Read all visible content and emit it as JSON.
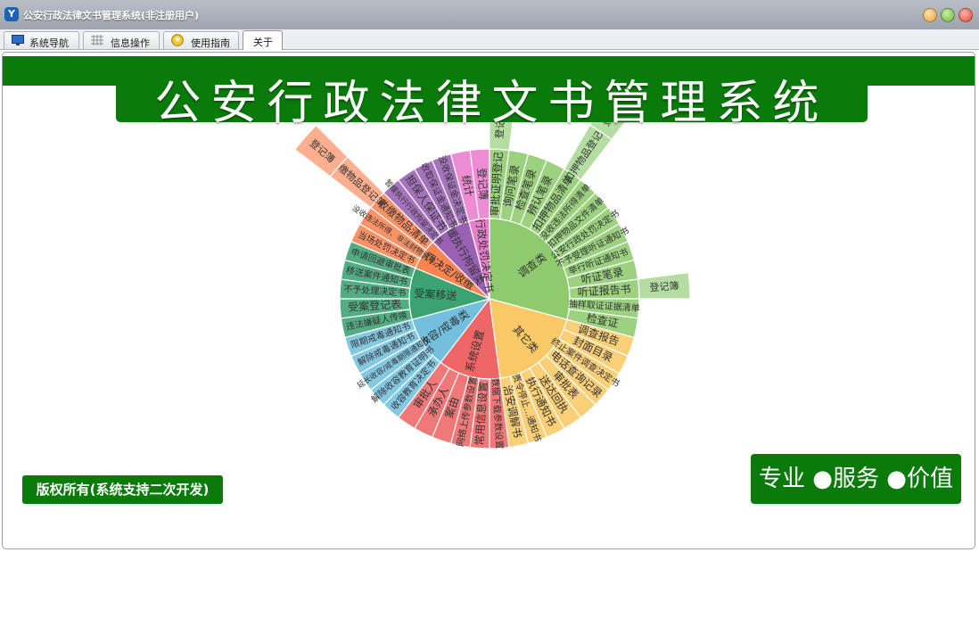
{
  "window": {
    "title": "公安行政法律文书管理系统(非注册用户)",
    "app_icon": "app-logo-icon",
    "controls": [
      {
        "name": "minimize-button",
        "color": "#e8a23c"
      },
      {
        "name": "maximize-button",
        "color": "#6ab33e"
      },
      {
        "name": "close-button",
        "color": "#e0463a"
      }
    ]
  },
  "tabs": [
    {
      "label": "系统导航",
      "icon": "monitor-icon",
      "active": false
    },
    {
      "label": "信息操作",
      "icon": "grid-icon",
      "active": false
    },
    {
      "label": "使用指南",
      "icon": "lightbulb-icon",
      "active": false
    },
    {
      "label": "关于",
      "icon": "",
      "active": true
    }
  ],
  "banner": {
    "title": "公安行政法律文书管理系统"
  },
  "footer": {
    "copyright": "版权所有(系统支持二次开发)",
    "slogan": "专业 ●服务 ●价值"
  },
  "colors": {
    "brand_green": "#0a7a0a"
  },
  "sunburst": {
    "categories": [
      {
        "name": "调查类",
        "color": "#8dcb6e",
        "items": [
          {
            "label": "审批证明登记",
            "outer": [
              "登记证"
            ]
          },
          {
            "label": "询问笔录",
            "outer": []
          },
          {
            "label": "检查笔录",
            "outer": []
          },
          {
            "label": "辨认笔录",
            "outer": []
          },
          {
            "label": "扣押物品清单",
            "outer": [
              "扣押物品登记簿",
              "登记簿"
            ]
          },
          {
            "label": "没收违法所得清单",
            "outer": []
          },
          {
            "label": "扣押物品文件清单",
            "outer": []
          },
          {
            "label": "公安行政处罚决定书",
            "outer": []
          },
          {
            "label": "不予受理听证通知书",
            "outer": []
          },
          {
            "label": "举行听证通知书",
            "outer": []
          },
          {
            "label": "听证笔录",
            "outer": []
          },
          {
            "label": "听证报告书",
            "outer": [
              "登记簿"
            ]
          },
          {
            "label": "抽样取证证据清单",
            "outer": []
          },
          {
            "label": "检查证",
            "outer": []
          }
        ]
      },
      {
        "name": "其它类",
        "color": "#f8c966",
        "items": [
          {
            "label": "调查报告",
            "outer": []
          },
          {
            "label": "封面目录",
            "outer": []
          },
          {
            "label": "终止案件调查决定书",
            "outer": []
          },
          {
            "label": "电话查询记录",
            "outer": []
          },
          {
            "label": "审批表",
            "outer": []
          },
          {
            "label": "送达回执",
            "outer": []
          },
          {
            "label": "执行通知书",
            "outer": []
          },
          {
            "label": "责令停止…通知书",
            "outer": []
          },
          {
            "label": "治安调解书",
            "outer": []
          }
        ]
      },
      {
        "name": "系统设置",
        "color": "#ee6666",
        "items": [
          {
            "label": "数据下载参数设置",
            "outer": []
          },
          {
            "label": "常用信息设置",
            "outer": []
          },
          {
            "label": "网络上传参数设置",
            "outer": []
          },
          {
            "label": "案由",
            "outer": []
          },
          {
            "label": "承办人",
            "outer": []
          },
          {
            "label": "审批人",
            "outer": []
          }
        ]
      },
      {
        "name": "收容/戒毒类",
        "color": "#73c0de",
        "items": [
          {
            "label": "收容教育决定书",
            "outer": []
          },
          {
            "label": "解除收容教育证明书",
            "outer": []
          },
          {
            "label": "延长收容/戒毒期限通知书",
            "outer": []
          },
          {
            "label": "解除戒毒通知书",
            "outer": []
          },
          {
            "label": "限期戒毒通知书",
            "outer": []
          }
        ]
      },
      {
        "name": "受案移送",
        "color": "#3ba272",
        "items": [
          {
            "label": "违法嫌疑人传唤",
            "outer": []
          },
          {
            "label": "受案登记表",
            "outer": []
          },
          {
            "label": "不予处理决定书",
            "outer": []
          },
          {
            "label": "移送案件通知书",
            "outer": []
          },
          {
            "label": "申请回避审批表",
            "outer": []
          }
        ]
      },
      {
        "name": "处罚决定/收缴",
        "color": "#fc8452",
        "items": [
          {
            "label": "当场处罚决定书",
            "outer": []
          },
          {
            "label": "没收违法所得、非法财物清单",
            "outer": []
          },
          {
            "label": "收缴物品清单",
            "outer": [
              "收缴物品登记簿",
              "登记簿"
            ]
          }
        ]
      },
      {
        "name": "暂缓执行拘留类",
        "color": "#9a60b4",
        "items": [
          {
            "label": "暂缓执行行政拘留决定书",
            "outer": []
          },
          {
            "label": "担保人保证书",
            "outer": []
          },
          {
            "label": "收取保证金通知书",
            "outer": []
          },
          {
            "label": "没收保证金决定书",
            "outer": []
          }
        ]
      },
      {
        "name": "公安行政处罚决定书",
        "color": "#ea7ccc",
        "items": [
          {
            "label": "统计",
            "outer": []
          },
          {
            "label": "登记簿",
            "outer": []
          }
        ]
      }
    ]
  }
}
